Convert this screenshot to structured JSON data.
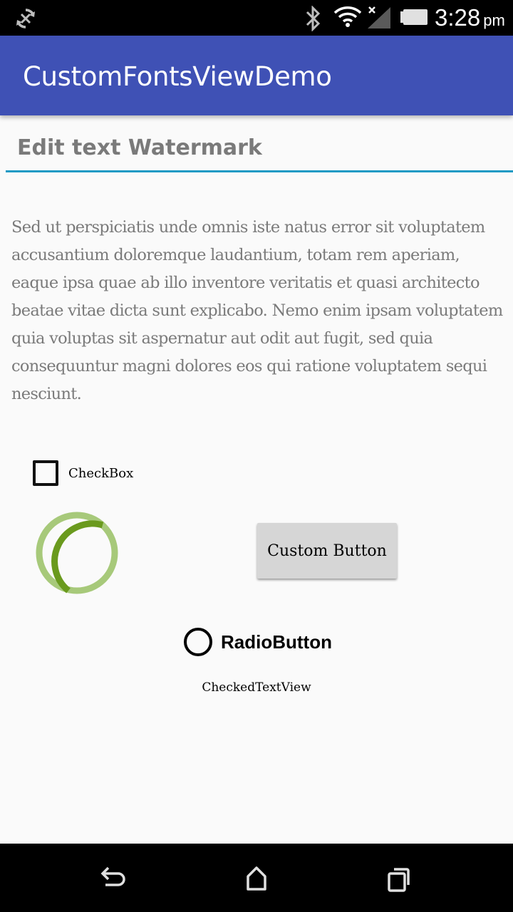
{
  "status_bar": {
    "icons": [
      "sync-icon",
      "bluetooth-icon",
      "wifi-icon",
      "cell-signal-icon",
      "battery-icon"
    ],
    "time": "3:28",
    "ampm": "pm"
  },
  "app_bar": {
    "title": "CustomFontsViewDemo",
    "color": "#3f51b5"
  },
  "edit_text": {
    "value": "",
    "placeholder": "Edit text Watermark",
    "underline_color": "#1e9ac4"
  },
  "body_text": "Sed ut perspiciatis unde omnis iste natus error sit voluptatem accusantium doloremque laudantium, totam rem aperiam, eaque ipsa quae ab illo inventore veritatis et quasi architecto beatae vitae dicta sunt explicabo. Nemo enim ipsam voluptatem quia voluptas sit aspernatur aut odit aut fugit, sed quia consequuntur magni dolores eos qui ratione voluptatem sequi nesciunt.",
  "checkbox": {
    "label": "CheckBox",
    "checked": false
  },
  "progress": {
    "type": "indeterminate-spinner",
    "color": "#6a9a1e"
  },
  "custom_button": {
    "label": "Custom Button"
  },
  "radio_button": {
    "label": "RadioButton",
    "checked": false
  },
  "checked_text_view": {
    "label": "CheckedTextView"
  },
  "nav_bar": {
    "icons": [
      "back-icon",
      "home-icon",
      "recents-icon"
    ]
  }
}
